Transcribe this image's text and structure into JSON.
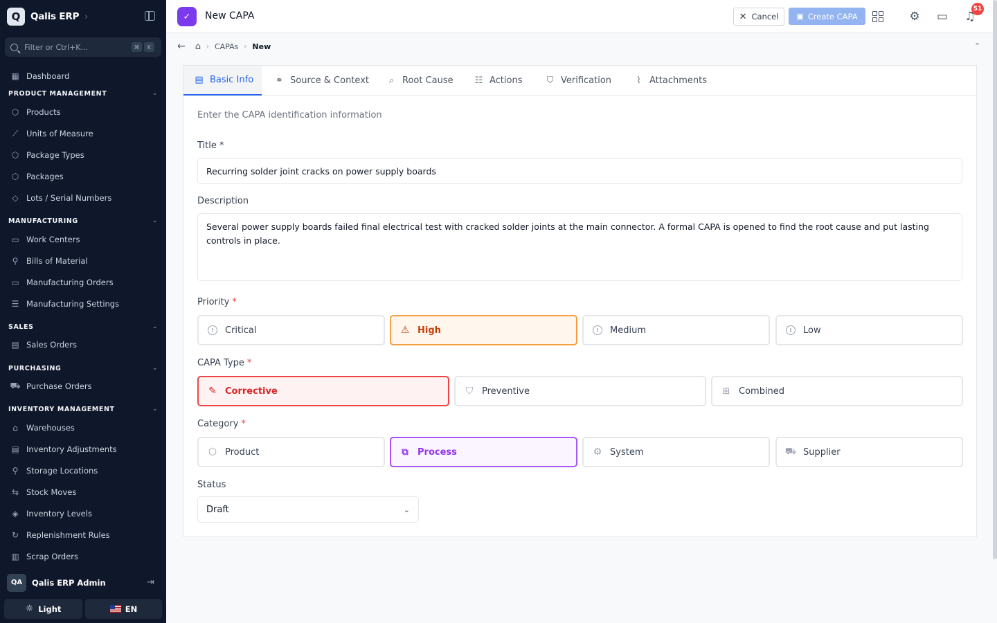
{
  "app": {
    "name": "Qalis ERP",
    "logo_letter": "Q"
  },
  "sidebar": {
    "search_placeholder": "Filter or Ctrl+K...",
    "shortcut_keys": [
      "⌘",
      "K"
    ],
    "dashboard": "Dashboard",
    "sections": [
      {
        "title": "PRODUCT MANAGEMENT",
        "items": [
          "Products",
          "Units of Measure",
          "Package Types",
          "Packages",
          "Lots / Serial Numbers"
        ]
      },
      {
        "title": "MANUFACTURING",
        "items": [
          "Work Centers",
          "Bills of Material",
          "Manufacturing Orders",
          "Manufacturing Settings"
        ]
      },
      {
        "title": "SALES",
        "items": [
          "Sales Orders"
        ]
      },
      {
        "title": "PURCHASING",
        "items": [
          "Purchase Orders"
        ]
      },
      {
        "title": "INVENTORY MANAGEMENT",
        "items": [
          "Warehouses",
          "Inventory Adjustments",
          "Storage Locations",
          "Stock Moves",
          "Inventory Levels",
          "Replenishment Rules",
          "Scrap Orders"
        ]
      }
    ],
    "user": {
      "initials": "QA",
      "name": "Qalis ERP Admin"
    },
    "theme_label": "Light",
    "language_label": "EN"
  },
  "header": {
    "title": "New CAPA",
    "cancel_label": "Cancel",
    "create_label": "Create CAPA",
    "notification_count": "51"
  },
  "breadcrumb": {
    "items": [
      "CAPAs",
      "New"
    ]
  },
  "tabs": [
    "Basic Info",
    "Source & Context",
    "Root Cause",
    "Actions",
    "Verification",
    "Attachments"
  ],
  "form": {
    "intro": "Enter the CAPA identification information",
    "title_label": "Title *",
    "title_value": "Recurring solder joint cracks on power supply boards",
    "description_label": "Description",
    "description_value": "Several power supply boards failed final electrical test with cracked solder joints at the main connector. A formal CAPA is opened to find the root cause and put lasting controls in place.",
    "priority_label": "Priority",
    "priority_options": [
      "Critical",
      "High",
      "Medium",
      "Low"
    ],
    "priority_selected": "High",
    "type_label": "CAPA Type",
    "type_options": [
      "Corrective",
      "Preventive",
      "Combined"
    ],
    "type_selected": "Corrective",
    "category_label": "Category",
    "category_options": [
      "Product",
      "Process",
      "System",
      "Supplier"
    ],
    "category_selected": "Process",
    "status_label": "Status",
    "status_value": "Draft",
    "required_mark": "*"
  },
  "colors": {
    "sidebar_bg": "#0f172a",
    "accent": "#2563eb",
    "brand_purple": "#7c3aed",
    "priority_high": "#f59e42",
    "type_corrective": "#ef4444",
    "category_process": "#a855f7"
  }
}
